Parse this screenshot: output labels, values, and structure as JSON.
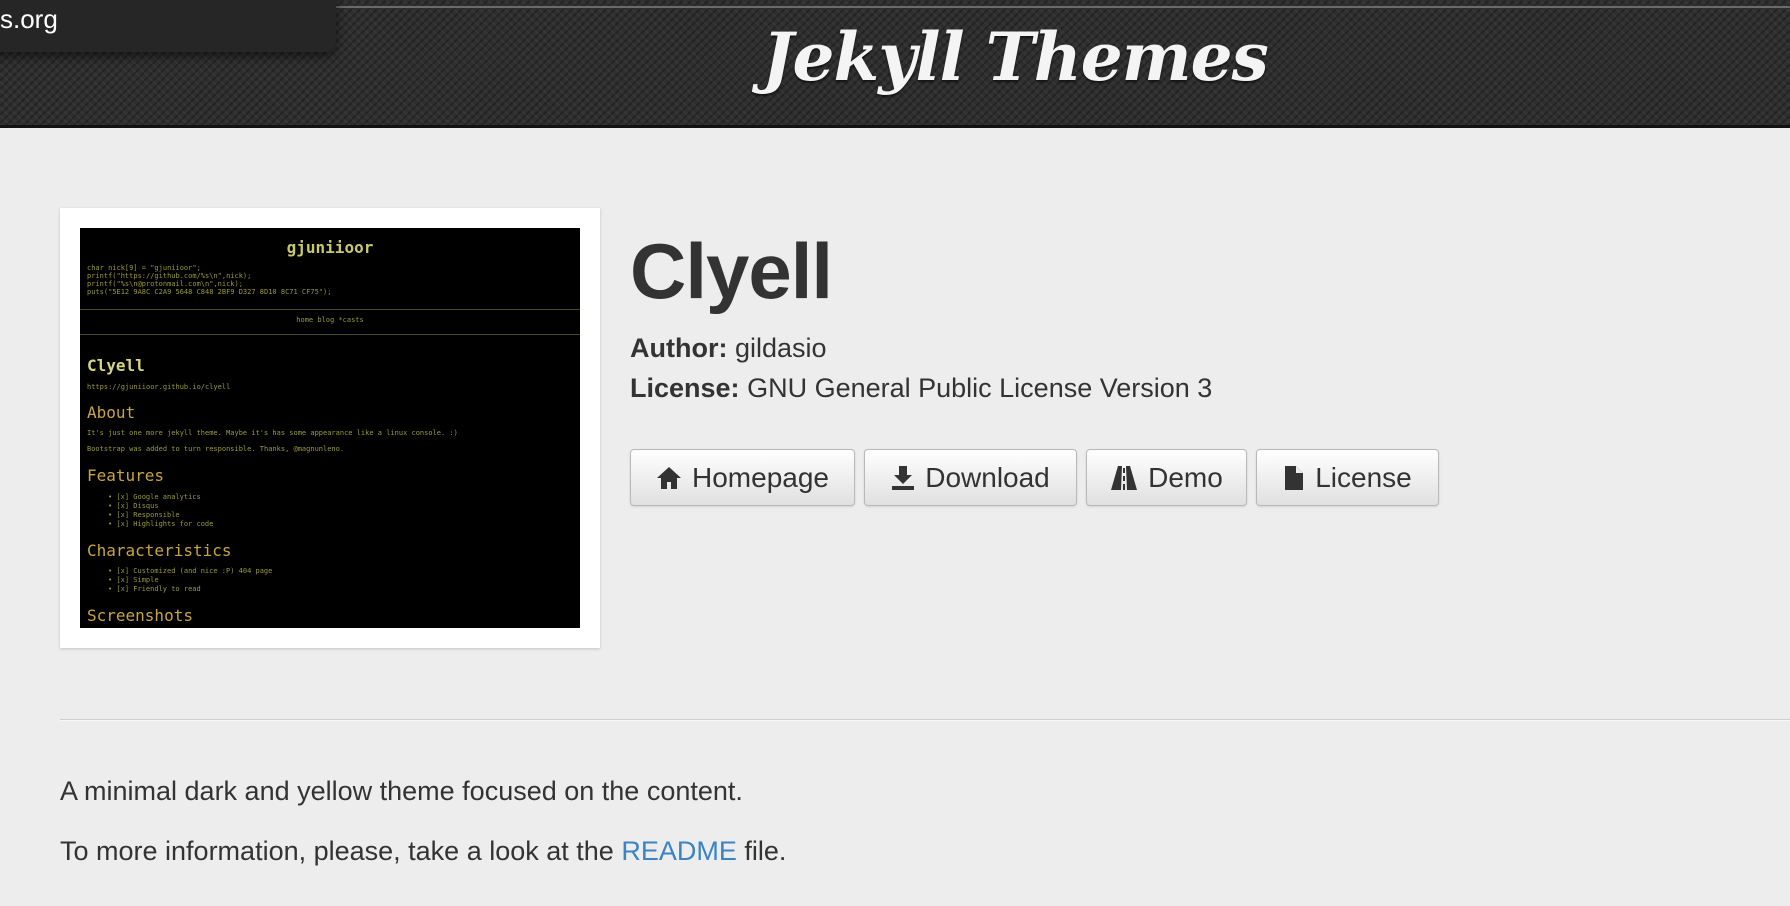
{
  "header": {
    "site_title": "Jekyll Themes",
    "tooltip_text": "s.org"
  },
  "preview": {
    "site_name": "gjuniioor",
    "code_lines": "char nick[9] = \"gjuniioor\";\nprintf(\"https://github.com/%s\\n\",nick);\nprintf(\"%s\\n@protonmail.com\\n\",nick);\nputs(\"5E12 9A8C C2A9 5648 C848 2BF9 D327 8D10 8C71 CF75\");",
    "nav": "home  blog  *casts",
    "heading": "Clyell",
    "url": "https://gjuniioor.github.io/clyell",
    "about_heading": "About",
    "about_text": "It's just one more jekyll theme. Maybe it's has some appearance like a linux console. :)",
    "about_text2": "Bootstrap was added to turn responsible. Thanks, @magnunleno.",
    "features_heading": "Features",
    "features_list": "• [x] Google analytics\n• [x] Disqus\n• [x] Responsible\n• [x] Highlights for code",
    "characteristics_heading": "Characteristics",
    "characteristics_list": "• [x] Customized (and nice :P) 404 page\n• [x] Simple\n• [x] Friendly to read",
    "screenshots_heading": "Screenshots"
  },
  "theme": {
    "name": "Clyell",
    "author_label": "Author:",
    "author": "gildasio",
    "license_label": "License:",
    "license": "GNU General Public License Version 3"
  },
  "buttons": {
    "homepage": "Homepage",
    "download": "Download",
    "demo": "Demo",
    "license": "License"
  },
  "description": {
    "line1": "A minimal dark and yellow theme focused on the content.",
    "line2_before": "To more information, please, take a look at the",
    "readme_link": "README",
    "line2_after": "file."
  },
  "colors": {
    "link": "#3a84c4",
    "header_bg": "#2f2f2f",
    "page_bg": "#ededed"
  }
}
